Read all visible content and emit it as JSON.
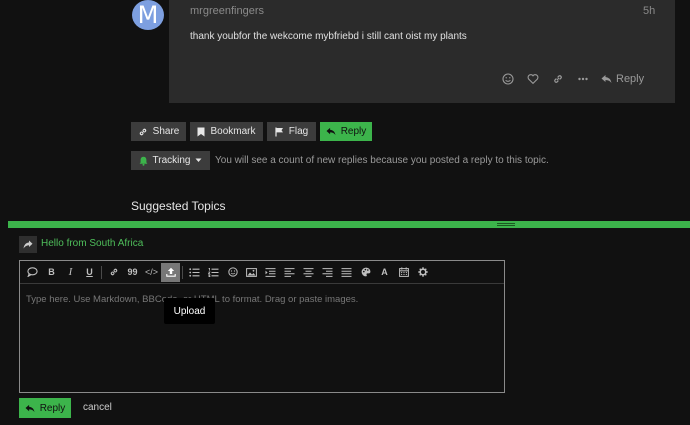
{
  "post": {
    "avatar_letter": "M",
    "avatar_color": "#7d9fe0",
    "username": "mrgreenfingers",
    "time": "5h",
    "body": "thank youbfor the wekcome mybfriebd i still cant oist my plants",
    "actions": {
      "icons": [
        "smile-icon",
        "heart-icon",
        "link-icon",
        "more-icon"
      ],
      "reply_label": "Reply"
    }
  },
  "topic_buttons": {
    "share": "Share",
    "bookmark": "Bookmark",
    "flag": "Flag",
    "reply": "Reply"
  },
  "tracking": {
    "label": "Tracking",
    "note": "You will see a count of new replies because you posted a reply to this topic."
  },
  "suggested_heading": "Suggested Topics",
  "composer": {
    "reply_to_title": "Hello from South Africa",
    "accent_color": "#3cb44b",
    "toolbar": {
      "bold": "B",
      "italic": "I",
      "underline": "U",
      "quote": "99",
      "code": "</>",
      "text_color": "A"
    },
    "placeholder": "Type here. Use Markdown, BBCode, or HTML to format. Drag or paste images.",
    "tooltip": "Upload",
    "reply_label": "Reply",
    "cancel_label": "cancel"
  }
}
